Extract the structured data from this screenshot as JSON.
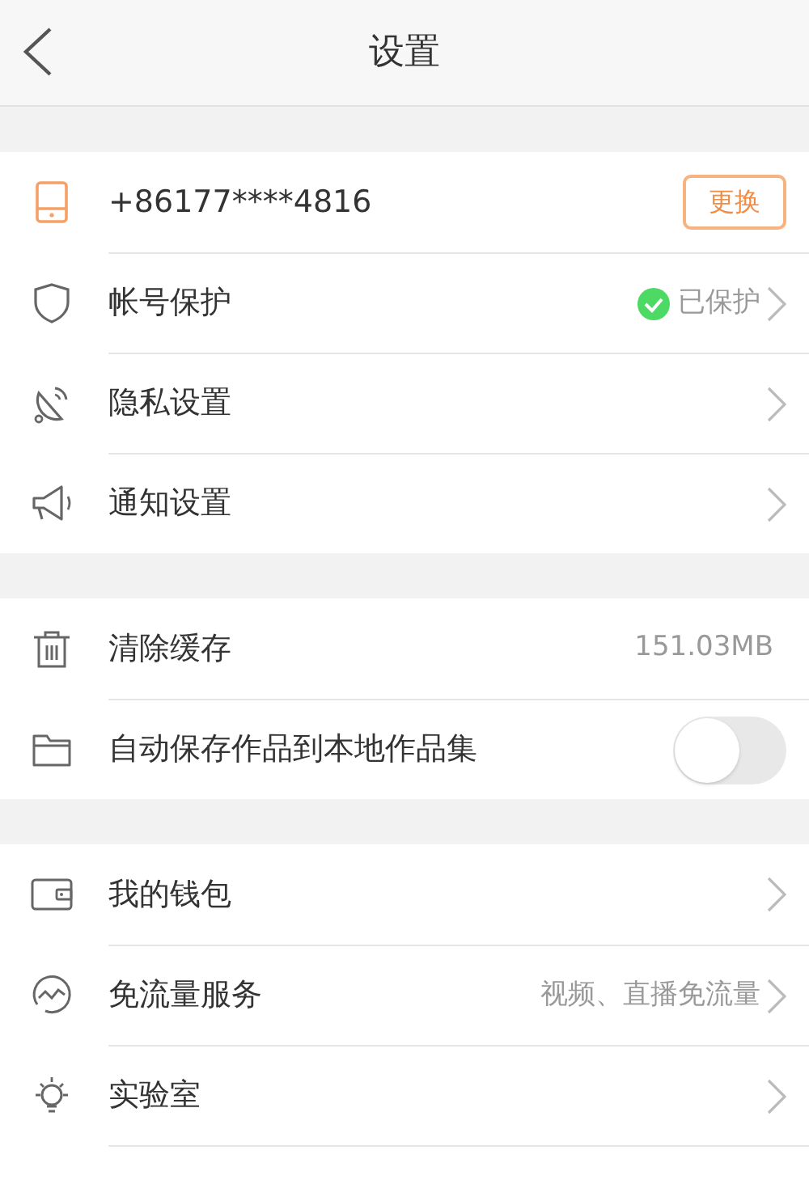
{
  "header": {
    "title": "设置"
  },
  "groups": [
    {
      "rows": [
        {
          "kind": "button",
          "label": "+86177****4816",
          "button": "更换"
        },
        {
          "kind": "status",
          "label": "帐号保护",
          "value": "已保护",
          "verified": true
        },
        {
          "kind": "link",
          "label": "隐私设置"
        },
        {
          "kind": "link",
          "label": "通知设置"
        }
      ]
    },
    {
      "rows": [
        {
          "kind": "value",
          "label": "清除缓存",
          "value": "151.03MB"
        },
        {
          "kind": "toggle",
          "label": "自动保存作品到本地作品集",
          "on": false
        }
      ]
    },
    {
      "rows": [
        {
          "kind": "link",
          "label": "我的钱包"
        },
        {
          "kind": "link",
          "label": "免流量服务",
          "value": "视频、直播免流量"
        },
        {
          "kind": "link",
          "label": "实验室"
        }
      ]
    }
  ]
}
